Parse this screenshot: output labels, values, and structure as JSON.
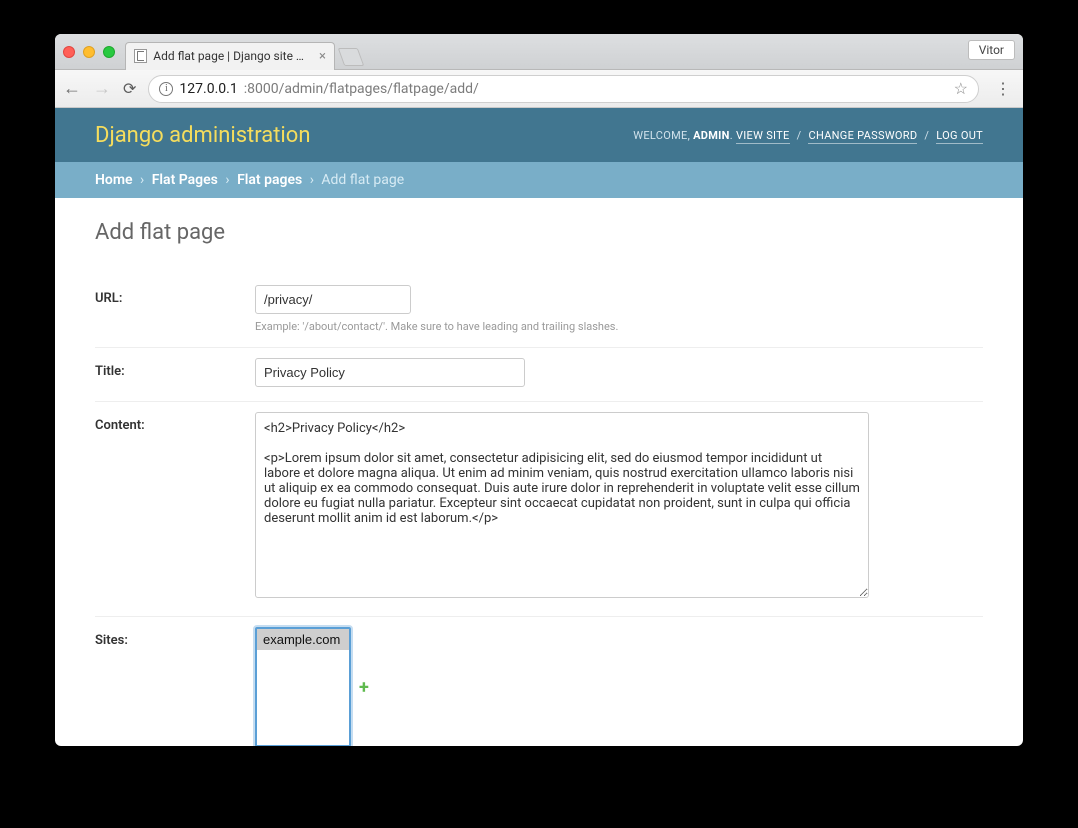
{
  "browser": {
    "profile_name": "Vitor",
    "tab_title": "Add flat page | Django site adm",
    "url_host": "127.0.0.1",
    "url_port_path": ":8000/admin/flatpages/flatpage/add/"
  },
  "header": {
    "site_title": "Django administration",
    "welcome_prefix": "WELCOME, ",
    "username": "ADMIN",
    "view_site": "VIEW SITE",
    "change_password": "CHANGE PASSWORD",
    "logout": "LOG OUT"
  },
  "breadcrumbs": {
    "home": "Home",
    "app": "Flat Pages",
    "model": "Flat pages",
    "current": "Add flat page"
  },
  "page": {
    "title": "Add flat page"
  },
  "form": {
    "url": {
      "label": "URL:",
      "value": "/privacy/",
      "help": "Example: '/about/contact/'. Make sure to have leading and trailing slashes."
    },
    "title": {
      "label": "Title:",
      "value": "Privacy Policy"
    },
    "content": {
      "label": "Content:",
      "value": "<h2>Privacy Policy</h2>\n\n<p>Lorem ipsum dolor sit amet, consectetur adipisicing elit, sed do eiusmod tempor incididunt ut labore et dolore magna aliqua. Ut enim ad minim veniam, quis nostrud exercitation ullamco laboris nisi ut aliquip ex ea commodo consequat. Duis aute irure dolor in reprehenderit in voluptate velit esse cillum dolore eu fugiat nulla pariatur. Excepteur sint occaecat cupidatat non proident, sunt in culpa qui officia deserunt mollit anim id est laborum.</p>"
    },
    "sites": {
      "label": "Sites:",
      "options": [
        "example.com"
      ],
      "selected": "example.com"
    }
  }
}
